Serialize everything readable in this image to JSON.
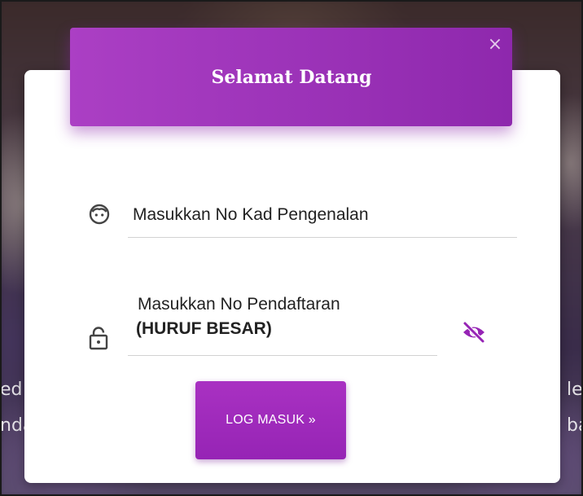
{
  "modal": {
    "title": "Selamat Datang",
    "close_symbol": "×",
    "accent_color": "#9c2ab8"
  },
  "fields": {
    "ic_number": {
      "placeholder": "Masukkan No Kad Pengenalan",
      "value": "",
      "icon": "face-icon"
    },
    "registration_number": {
      "placeholder_line1": "Masukkan No Pendaftaran",
      "placeholder_line2": "(HURUF BESAR)",
      "value": "",
      "icon": "lock-icon",
      "toggle_icon": "eye-off-icon"
    }
  },
  "login_button": {
    "label": "LOG MASUK »"
  },
  "background": {
    "left_fragments": [
      "ed",
      "nda"
    ],
    "right_fragments": [
      "le",
      "bai"
    ]
  }
}
